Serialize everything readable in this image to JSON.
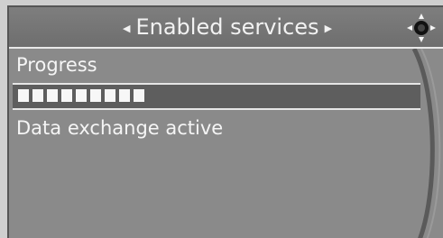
{
  "header": {
    "title": "Enabled services",
    "left_arrow_icon": "triangle-left",
    "right_arrow_icon": "triangle-right",
    "controller_icon": "idrive-controller-icon"
  },
  "progress": {
    "label": "Progress",
    "filled_blocks": 9,
    "status": "Data exchange active"
  },
  "colors": {
    "background": "#8a8a8a",
    "title_bar": "#767676",
    "text": "#f5f5f5",
    "progress_track": "#5e5e5e",
    "progress_fill": "#f7f7f7"
  }
}
